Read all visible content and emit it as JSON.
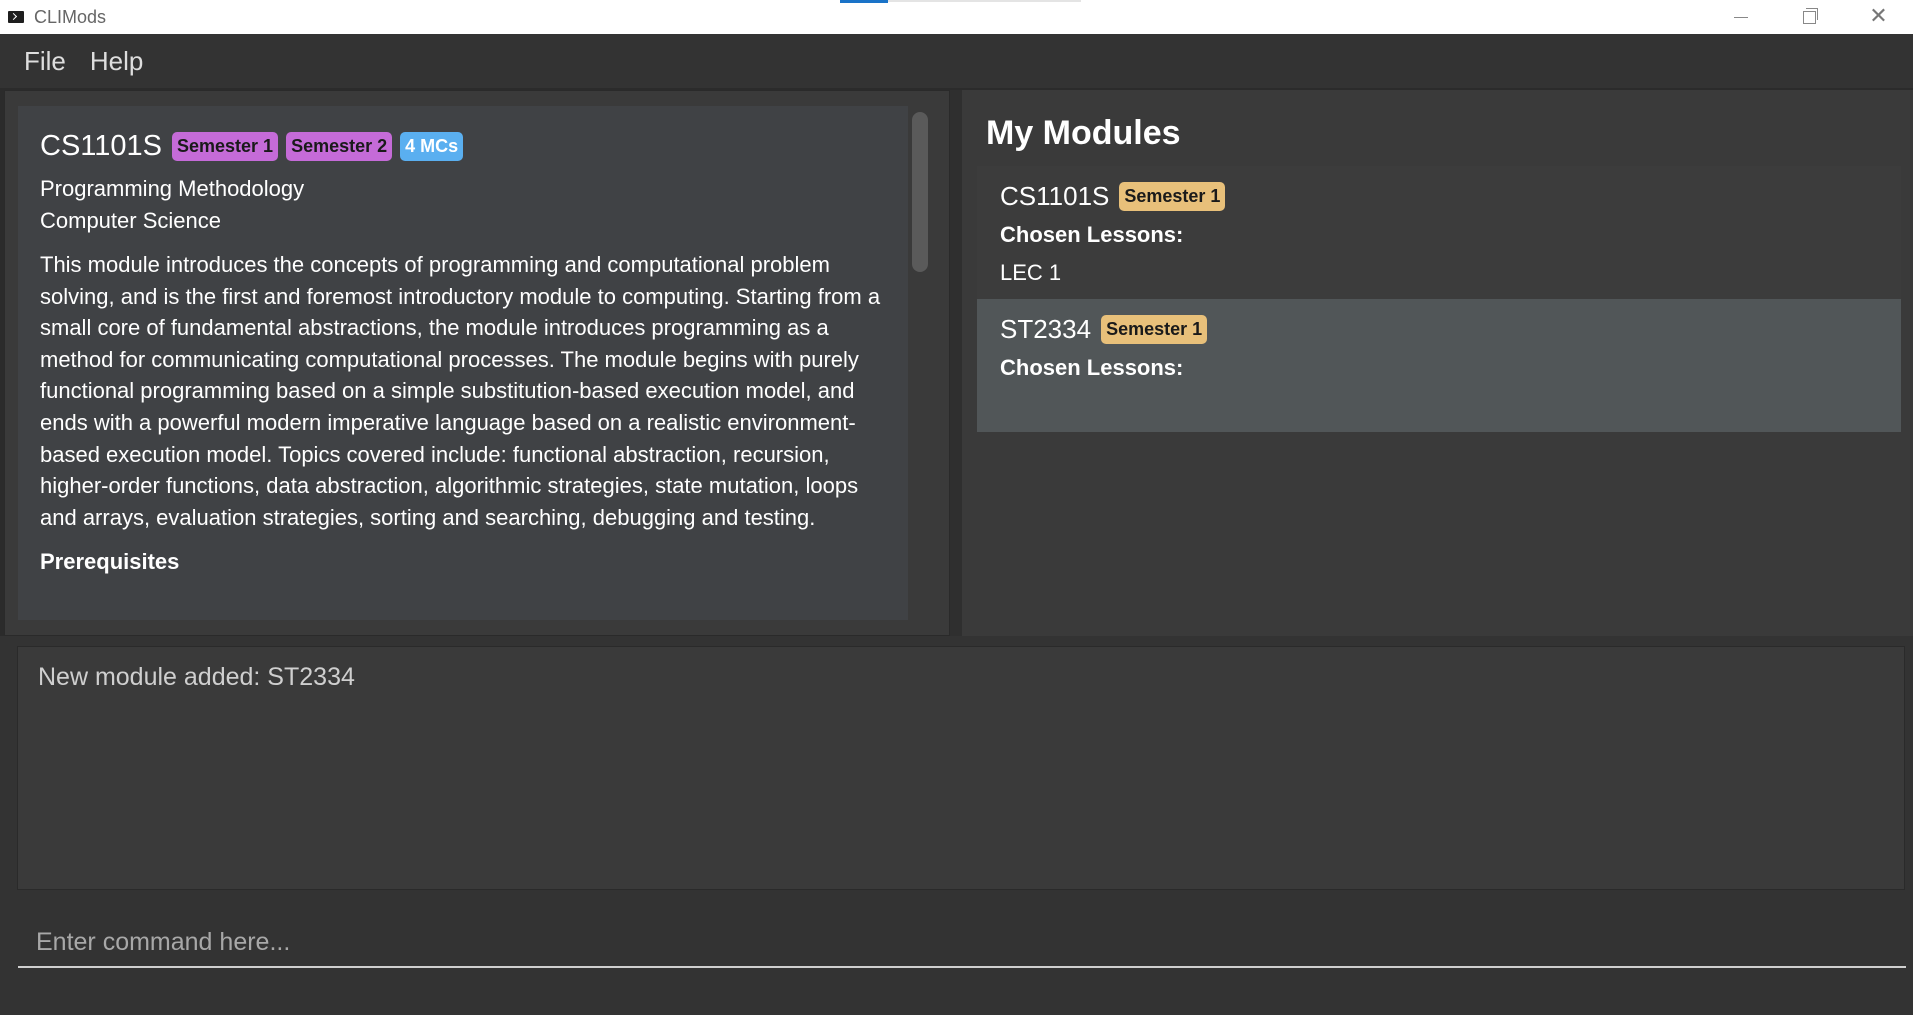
{
  "window": {
    "title": "CLIMods",
    "controls": [
      "minimize",
      "maximize",
      "close"
    ]
  },
  "menu": {
    "items": [
      {
        "label": "File"
      },
      {
        "label": "Help"
      }
    ]
  },
  "detail": {
    "code": "CS1101S",
    "badges": [
      "Semester 1",
      "Semester 2",
      "4 MCs"
    ],
    "title": "Programming Methodology",
    "department": "Computer Science",
    "description": "This module introduces the concepts of programming and computational problem solving, and is the first and foremost introductory module to computing. Starting from a small core of fundamental abstractions, the module introduces programming as a method for communicating computational processes. The module begins with purely functional programming based on a simple substitution-based execution model, and ends with a powerful modern imperative language based on a realistic environment-based execution model. Topics covered include: functional abstraction, recursion, higher-order functions, data abstraction, algorithmic strategies, state mutation, loops and arrays, evaluation strategies, sorting and searching, debugging and testing.",
    "prereq_heading": "Prerequisites"
  },
  "my_modules": {
    "title": "My Modules",
    "modules": [
      {
        "code": "CS1101S",
        "semester": "Semester 1",
        "lessons_label": "Chosen Lessons:",
        "lessons": [
          "LEC 1"
        ]
      },
      {
        "code": "ST2334",
        "semester": "Semester 1",
        "lessons_label": "Chosen Lessons:",
        "lessons": []
      }
    ]
  },
  "result": {
    "message": "New module added: ST2334"
  },
  "command": {
    "placeholder": "Enter command here...",
    "value": ""
  },
  "colors": {
    "background": "#2b2b2b",
    "panel": "#3a3a3a",
    "card": "#404245",
    "selected_row": "#515658",
    "badge_purple": "#c56bd8",
    "badge_blue": "#5aaff0",
    "badge_gold": "#e8c07a"
  }
}
